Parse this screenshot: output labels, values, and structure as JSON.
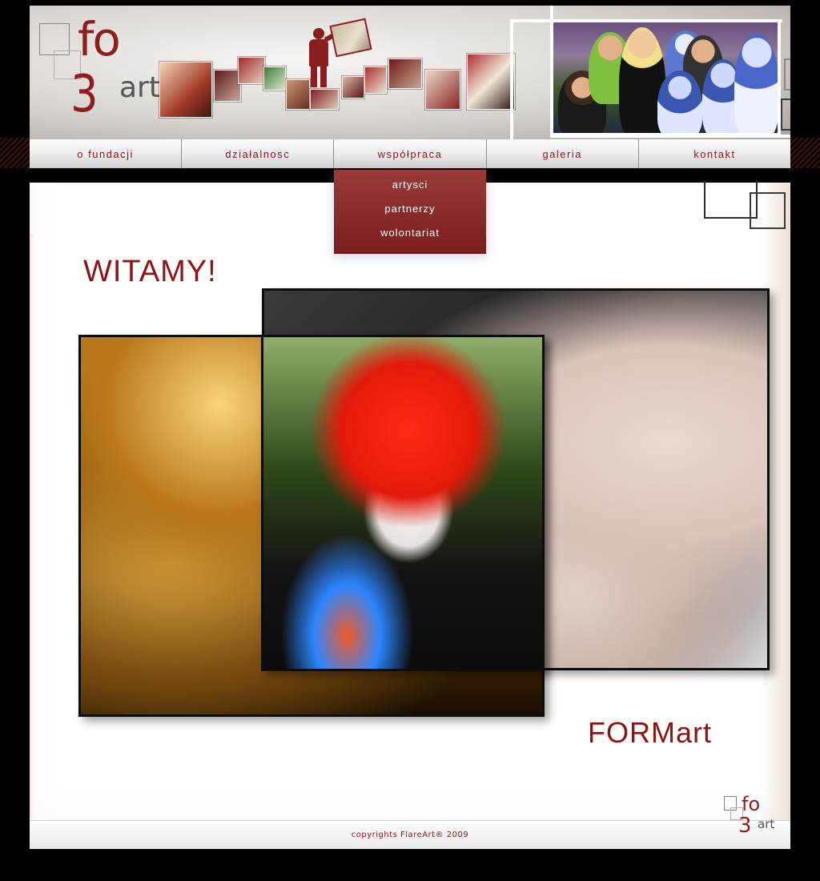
{
  "header": {
    "logo_text": {
      "fo": "fo",
      "three": "3",
      "art": "art"
    }
  },
  "nav": {
    "items": [
      {
        "label": "o fundacji"
      },
      {
        "label": "działalnosc"
      },
      {
        "label": "współpraca"
      },
      {
        "label": "galeria"
      },
      {
        "label": "kontakt"
      }
    ]
  },
  "dropdown": {
    "items": [
      {
        "label": "artysci"
      },
      {
        "label": "partnerzy"
      },
      {
        "label": "wolontariat"
      }
    ]
  },
  "main": {
    "heading": "WITAMY!",
    "brand": "FORMart"
  },
  "footer": {
    "copyright": "copyrights FlareArt® 2009"
  },
  "colors": {
    "accent": "#8e1414",
    "dropdown": "#7a1d1d",
    "background": "#000000"
  }
}
